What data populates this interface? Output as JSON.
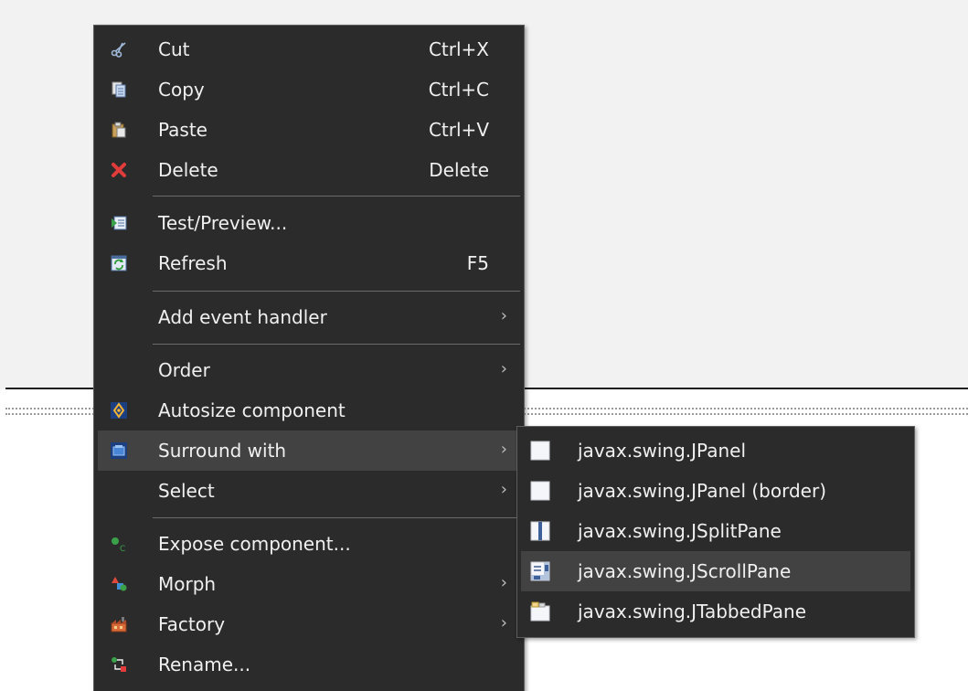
{
  "context_menu": {
    "items": [
      {
        "label": "Cut",
        "shortcut": "Ctrl+X",
        "icon": "scissors-icon"
      },
      {
        "label": "Copy",
        "shortcut": "Ctrl+C",
        "icon": "copy-icon"
      },
      {
        "label": "Paste",
        "shortcut": "Ctrl+V",
        "icon": "paste-icon"
      },
      {
        "label": "Delete",
        "shortcut": "Delete",
        "icon": "delete-icon"
      },
      {
        "label": "Test/Preview...",
        "shortcut": "",
        "icon": "preview-icon"
      },
      {
        "label": "Refresh",
        "shortcut": "F5",
        "icon": "refresh-icon"
      },
      {
        "label": "Add event handler",
        "shortcut": "",
        "has_submenu": true
      },
      {
        "label": "Order",
        "shortcut": "",
        "has_submenu": true
      },
      {
        "label": "Autosize component",
        "shortcut": "",
        "icon": "autosize-icon"
      },
      {
        "label": "Surround with",
        "shortcut": "",
        "icon": "surround-icon",
        "has_submenu": true,
        "state": "highlighted"
      },
      {
        "label": "Select",
        "shortcut": "",
        "has_submenu": true
      },
      {
        "label": "Expose component...",
        "shortcut": "",
        "icon": "expose-icon"
      },
      {
        "label": "Morph",
        "shortcut": "",
        "icon": "morph-icon",
        "has_submenu": true
      },
      {
        "label": "Factory",
        "shortcut": "",
        "icon": "factory-icon",
        "has_submenu": true
      },
      {
        "label": "Rename...",
        "shortcut": "",
        "icon": "rename-icon"
      }
    ],
    "submenu_arrow": "›"
  },
  "surround_submenu": {
    "items": [
      {
        "label": "javax.swing.JPanel",
        "icon": "panel-icon"
      },
      {
        "label": "javax.swing.JPanel (border)",
        "icon": "panel-border-icon"
      },
      {
        "label": "javax.swing.JSplitPane",
        "icon": "split-pane-icon"
      },
      {
        "label": "javax.swing.JScrollPane",
        "icon": "scroll-pane-icon",
        "state": "highlighted"
      },
      {
        "label": "javax.swing.JTabbedPane",
        "icon": "tabbed-pane-icon"
      }
    ]
  },
  "colors": {
    "menu_background": "#2b2b2b",
    "menu_text": "#f0f0f0",
    "highlight": "#424242",
    "canvas_background": "#f2f2f2"
  }
}
